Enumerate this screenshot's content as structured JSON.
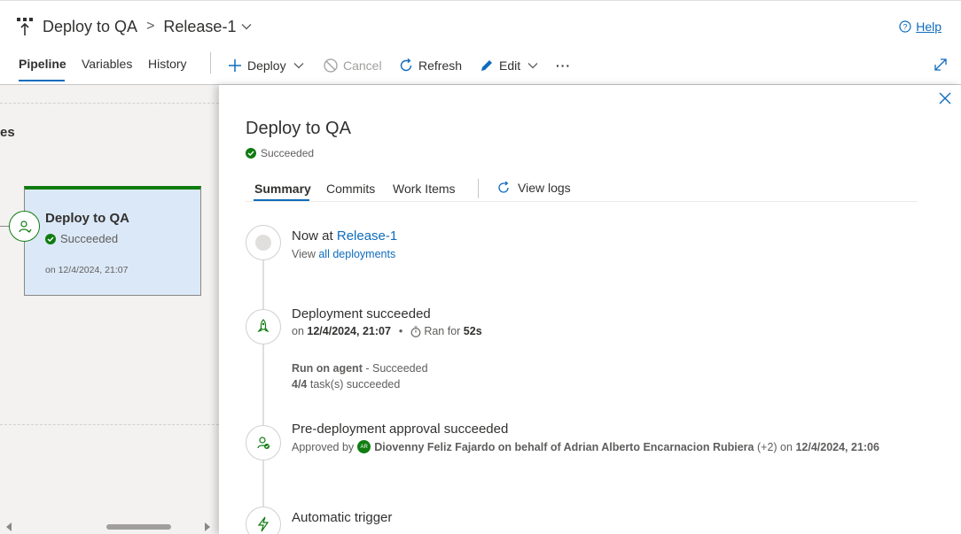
{
  "header": {
    "pipeline_title": "Deploy to QA",
    "breadcrumb_separator": ">",
    "release_name": "Release-1",
    "help_label": "Help"
  },
  "nav": {
    "tabs": [
      {
        "label": "Pipeline",
        "active": true
      },
      {
        "label": "Variables",
        "active": false
      },
      {
        "label": "History",
        "active": false
      }
    ]
  },
  "toolbar": {
    "deploy_label": "Deploy",
    "cancel_label": "Cancel",
    "refresh_label": "Refresh",
    "edit_label": "Edit",
    "more_label": "···"
  },
  "canvas": {
    "partial_label": "es",
    "stage": {
      "name": "Deploy to QA",
      "status": "Succeeded",
      "date": "on 12/4/2024, 21:07"
    }
  },
  "panel": {
    "title": "Deploy to QA",
    "status": "Succeeded",
    "tabs": [
      {
        "label": "Summary",
        "active": true
      },
      {
        "label": "Commits",
        "active": false
      },
      {
        "label": "Work Items",
        "active": false
      }
    ],
    "view_logs_label": "View logs",
    "timeline": {
      "now_at_prefix": "Now at",
      "now_at_release": "Release-1",
      "view_prefix": "View",
      "view_link": "all deployments",
      "deployment_title": "Deployment succeeded",
      "deployment_on_prefix": "on",
      "deployment_date": "12/4/2024, 21:07",
      "ran_for_prefix": "Ran for",
      "ran_for_value": "52s",
      "run_on_agent_label": "Run on agent",
      "run_on_agent_status": "- Succeeded",
      "tasks_count": "4/4",
      "tasks_suffix": "task(s) succeeded",
      "approval_title": "Pre-deployment approval succeeded",
      "approved_by_prefix": "Approved by",
      "approver_initials": "AR",
      "approver_text": "Diovenny Feliz Fajardo on behalf of Adrian Alberto Encarnacion Rubiera",
      "approver_extra": "(+2) on",
      "approval_date": "12/4/2024, 21:06",
      "trigger_title": "Automatic trigger"
    }
  },
  "colors": {
    "accent": "#0f6cbd",
    "success": "#107c10",
    "stage_card_bg": "#dbe8f7"
  }
}
